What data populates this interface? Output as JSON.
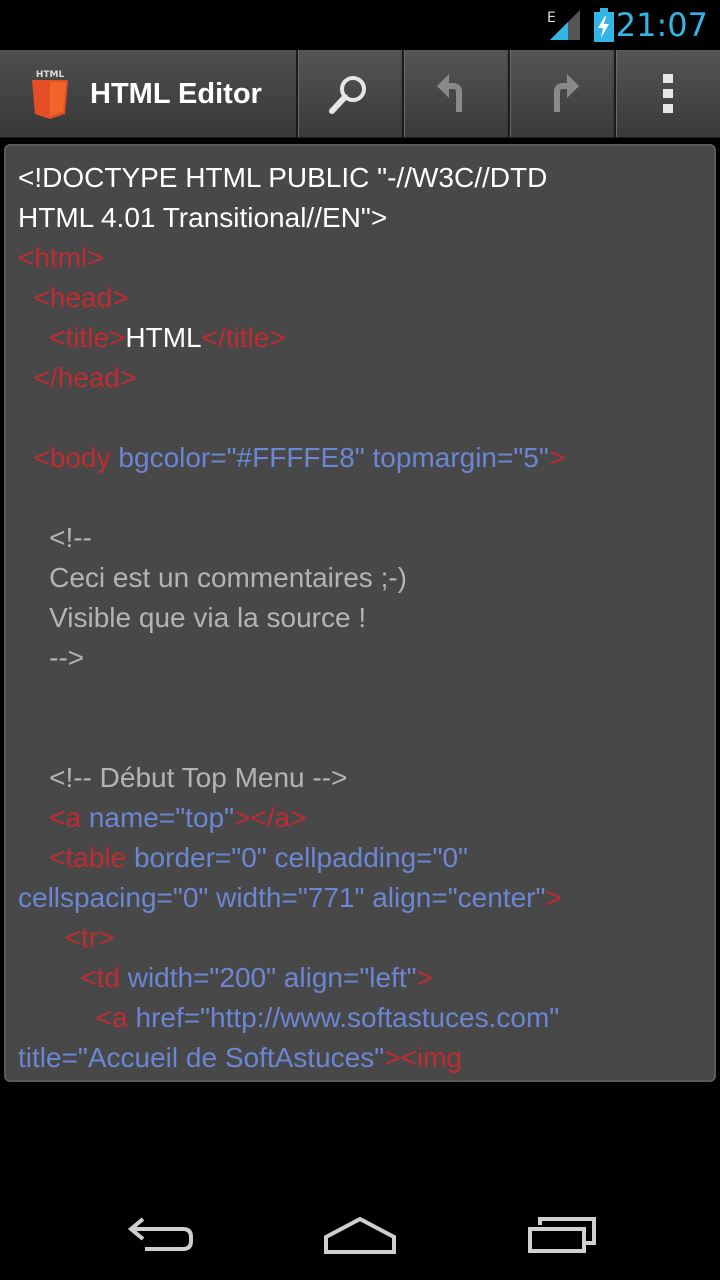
{
  "status_bar": {
    "network_type": "E",
    "time": "21:07",
    "icons": [
      "signal-icon",
      "battery-charging-icon"
    ],
    "accent_color": "#33b5e5"
  },
  "action_bar": {
    "app_icon_label": "HTML",
    "title": "HTML Editor",
    "actions": [
      "search-icon",
      "undo-icon",
      "redo-icon",
      "overflow-menu-icon"
    ]
  },
  "editor": {
    "colors": {
      "tag": "#c02b31",
      "attr": "#6b87d4",
      "text": "#ffffff",
      "comment": "#b4b4b4"
    },
    "lines": [
      [
        [
          "text",
          "<!DOCTYPE HTML PUBLIC \"-//W3C//DTD"
        ]
      ],
      [
        [
          "text",
          "HTML 4.01 Transitional//EN\">"
        ]
      ],
      [
        [
          "tag",
          "<html>"
        ]
      ],
      [
        [
          "text",
          "  "
        ],
        [
          "tag",
          "<head>"
        ]
      ],
      [
        [
          "text",
          "    "
        ],
        [
          "tag",
          "<title>"
        ],
        [
          "text",
          "HTML"
        ],
        [
          "tag",
          "</title>"
        ]
      ],
      [
        [
          "text",
          "  "
        ],
        [
          "tag",
          "</head>"
        ]
      ],
      [],
      [
        [
          "text",
          "  "
        ],
        [
          "tag",
          "<body"
        ],
        [
          "attr",
          " bgcolor=\"#FFFFE8\" topmargin=\"5\""
        ],
        [
          "tag",
          ">"
        ]
      ],
      [],
      [
        [
          "cmt",
          "    <!--"
        ]
      ],
      [
        [
          "cmt",
          "    Ceci est un commentaires ;-)"
        ]
      ],
      [
        [
          "cmt",
          "    Visible que via la source !"
        ]
      ],
      [
        [
          "cmt",
          "    -->"
        ]
      ],
      [],
      [],
      [
        [
          "cmt",
          "    <!-- Début Top Menu -->"
        ]
      ],
      [
        [
          "text",
          "    "
        ],
        [
          "tag",
          "<a"
        ],
        [
          "attr",
          " name=\"top\""
        ],
        [
          "tag",
          "></a>"
        ]
      ],
      [
        [
          "text",
          "    "
        ],
        [
          "tag",
          "<table"
        ],
        [
          "attr",
          " border=\"0\" cellpadding=\"0\""
        ]
      ],
      [
        [
          "attr",
          "cellspacing=\"0\" width=\"771\" align=\"center\""
        ],
        [
          "tag",
          ">"
        ]
      ],
      [
        [
          "text",
          "      "
        ],
        [
          "tag",
          "<tr>"
        ]
      ],
      [
        [
          "text",
          "        "
        ],
        [
          "tag",
          "<td"
        ],
        [
          "attr",
          " width=\"200\" align=\"left\""
        ],
        [
          "tag",
          ">"
        ]
      ],
      [
        [
          "text",
          "          "
        ],
        [
          "tag",
          "<a"
        ],
        [
          "attr",
          " href=\"http://www.softastuces.com\""
        ]
      ],
      [
        [
          "attr",
          "title=\"Accueil de SoftAstuces\""
        ],
        [
          "tag",
          "><img"
        ]
      ]
    ]
  },
  "nav_bar": {
    "buttons": [
      "back-icon",
      "home-icon",
      "recent-apps-icon"
    ]
  }
}
